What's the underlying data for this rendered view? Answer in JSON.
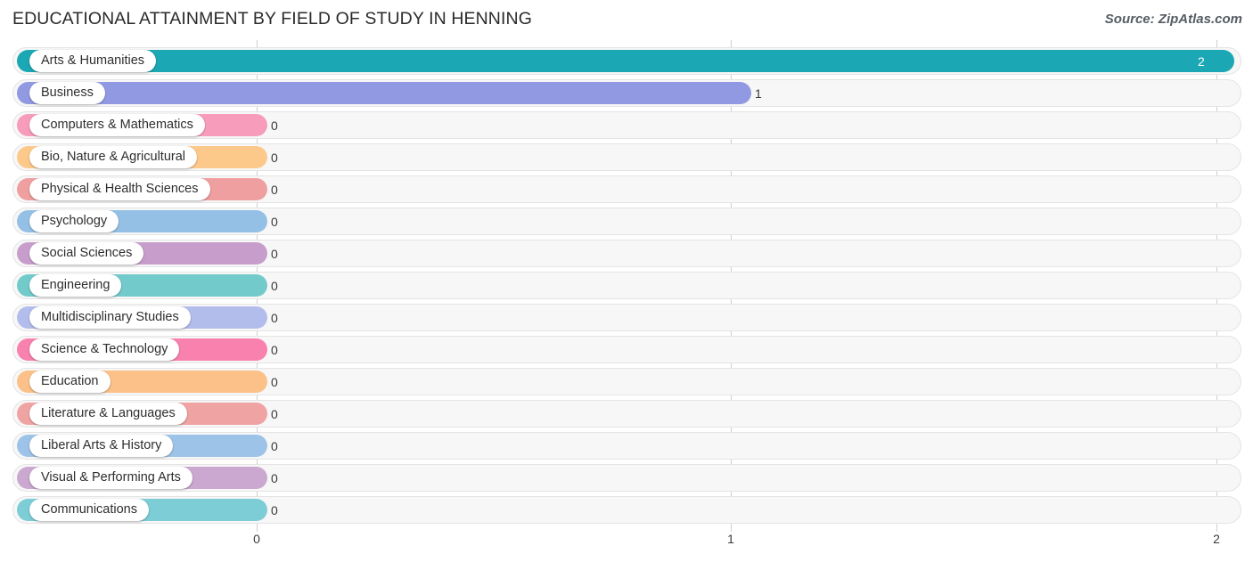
{
  "header": {
    "title": "EDUCATIONAL ATTAINMENT BY FIELD OF STUDY IN HENNING",
    "source": "Source: ZipAtlas.com"
  },
  "chart_data": {
    "type": "bar",
    "orientation": "horizontal",
    "title": "EDUCATIONAL ATTAINMENT BY FIELD OF STUDY IN HENNING",
    "xlabel": "",
    "ylabel": "",
    "xlim": [
      0,
      2
    ],
    "xticks": [
      "0",
      "1",
      "2"
    ],
    "xtick_values": [
      0,
      1,
      2
    ],
    "grid": true,
    "legend": false,
    "categories": [
      "Arts & Humanities",
      "Business",
      "Computers & Mathematics",
      "Bio, Nature & Agricultural",
      "Physical & Health Sciences",
      "Psychology",
      "Social Sciences",
      "Engineering",
      "Multidisciplinary Studies",
      "Science & Technology",
      "Education",
      "Literature & Languages",
      "Liberal Arts & History",
      "Visual & Performing Arts",
      "Communications"
    ],
    "values": [
      2,
      1,
      0,
      0,
      0,
      0,
      0,
      0,
      0,
      0,
      0,
      0,
      0,
      0,
      0
    ],
    "value_labels": [
      "2",
      "1",
      "0",
      "0",
      "0",
      "0",
      "0",
      "0",
      "0",
      "0",
      "0",
      "0",
      "0",
      "0",
      "0"
    ],
    "colors": [
      "#1ba7b4",
      "#9199e2",
      "#f79dbb",
      "#fcc98b",
      "#ef9f9f",
      "#94c0e5",
      "#c79ecb",
      "#72cacb",
      "#b3bdec",
      "#f981ad",
      "#fbc189",
      "#f0a3a3",
      "#9ec3e8",
      "#cba8cf",
      "#7ccdd6"
    ]
  },
  "rows": [
    {
      "label": "Arts & Humanities",
      "value_label": "2",
      "color": "#1ba7b4",
      "value_inside": true
    },
    {
      "label": "Business",
      "value_label": "1",
      "color": "#9199e2",
      "value_inside": false
    },
    {
      "label": "Computers & Mathematics",
      "value_label": "0",
      "color": "#f79dbb",
      "value_inside": false
    },
    {
      "label": "Bio, Nature & Agricultural",
      "value_label": "0",
      "color": "#fcc98b",
      "value_inside": false
    },
    {
      "label": "Physical & Health Sciences",
      "value_label": "0",
      "color": "#ef9f9f",
      "value_inside": false
    },
    {
      "label": "Psychology",
      "value_label": "0",
      "color": "#94c0e5",
      "value_inside": false
    },
    {
      "label": "Social Sciences",
      "value_label": "0",
      "color": "#c79ecb",
      "value_inside": false
    },
    {
      "label": "Engineering",
      "value_label": "0",
      "color": "#72cacb",
      "value_inside": false
    },
    {
      "label": "Multidisciplinary Studies",
      "value_label": "0",
      "color": "#b3bdec",
      "value_inside": false
    },
    {
      "label": "Science & Technology",
      "value_label": "0",
      "color": "#f981ad",
      "value_inside": false
    },
    {
      "label": "Education",
      "value_label": "0",
      "color": "#fbc189",
      "value_inside": false
    },
    {
      "label": "Literature & Languages",
      "value_label": "0",
      "color": "#f0a3a3",
      "value_inside": false
    },
    {
      "label": "Liberal Arts & History",
      "value_label": "0",
      "color": "#9ec3e8",
      "value_inside": false
    },
    {
      "label": "Visual & Performing Arts",
      "value_label": "0",
      "color": "#cba8cf",
      "value_inside": false
    },
    {
      "label": "Communications",
      "value_label": "0",
      "color": "#7ccdd6",
      "value_inside": false
    }
  ],
  "axis": {
    "ticks": [
      "0",
      "1",
      "2"
    ]
  }
}
